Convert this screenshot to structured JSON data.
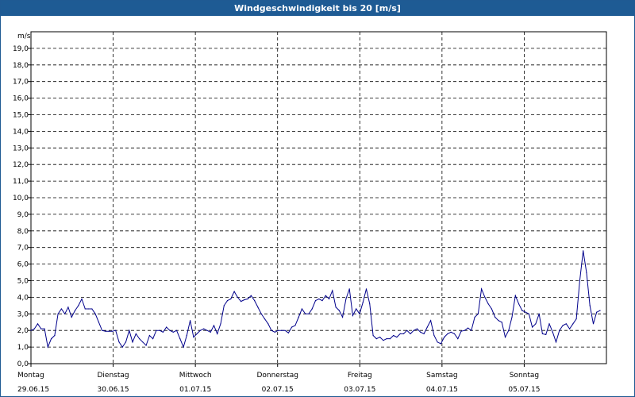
{
  "window": {
    "title": "Windgeschwindigkeit bis 20 [m/s]"
  },
  "chart_data": {
    "type": "line",
    "title": "Windgeschwindigkeit bis 20 [m/s]",
    "ylabel": "m/s",
    "xlabel": "",
    "ylim": [
      0,
      20
    ],
    "y_ticks": [
      "0,0",
      "1,0",
      "2,0",
      "3,0",
      "4,0",
      "5,0",
      "6,0",
      "7,0",
      "8,0",
      "9,0",
      "10,0",
      "11,0",
      "12,0",
      "13,0",
      "14,0",
      "15,0",
      "16,0",
      "17,0",
      "18,0",
      "19,0"
    ],
    "x_ticks": [
      {
        "day": "Montag",
        "date": "29.06.15"
      },
      {
        "day": "Dienstag",
        "date": "30.06.15"
      },
      {
        "day": "Mittwoch",
        "date": "01.07.15"
      },
      {
        "day": "Donnerstag",
        "date": "02.07.15"
      },
      {
        "day": "Freitag",
        "date": "03.07.15"
      },
      {
        "day": "Samstag",
        "date": "04.07.15"
      },
      {
        "day": "Sonntag",
        "date": "05.07.15"
      }
    ],
    "grid": true,
    "series": [
      {
        "color": "#00008b",
        "values": [
          2.0,
          2.1,
          2.4,
          2.1,
          2.1,
          1.0,
          1.5,
          1.7,
          3.0,
          3.3,
          3.0,
          3.4,
          2.8,
          3.2,
          3.5,
          3.9,
          3.3,
          3.3,
          3.3,
          3.0,
          2.5,
          2.0,
          1.95,
          1.95,
          1.95,
          2.0,
          1.3,
          1.0,
          1.3,
          2.0,
          1.3,
          1.8,
          1.5,
          1.3,
          1.1,
          1.7,
          1.5,
          2.0,
          2.0,
          1.9,
          2.2,
          2.0,
          1.9,
          2.0,
          1.5,
          1.0,
          1.7,
          2.6,
          1.6,
          1.8,
          2.0,
          2.1,
          2.0,
          1.9,
          2.3,
          1.8,
          2.4,
          3.5,
          3.8,
          3.9,
          4.35,
          4.0,
          3.75,
          3.85,
          3.9,
          4.1,
          3.8,
          3.4,
          3.0,
          2.7,
          2.4,
          2.0,
          1.9,
          2.0,
          2.0,
          2.0,
          1.85,
          2.2,
          2.3,
          2.8,
          3.3,
          3.0,
          3.0,
          3.3,
          3.8,
          3.9,
          3.8,
          4.1,
          3.9,
          4.4,
          3.4,
          3.2,
          2.8,
          3.9,
          4.5,
          2.9,
          3.3,
          3.0,
          3.7,
          4.5,
          3.6,
          1.7,
          1.5,
          1.6,
          1.4,
          1.5,
          1.5,
          1.7,
          1.6,
          1.8,
          1.8,
          2.0,
          1.8,
          2.0,
          2.1,
          1.9,
          1.8,
          2.2,
          2.6,
          1.7,
          1.3,
          1.2,
          1.6,
          1.8,
          1.9,
          1.8,
          1.5,
          1.95,
          2.0,
          2.15,
          2.0,
          2.8,
          3.0,
          4.5,
          4.0,
          3.6,
          3.3,
          2.8,
          2.6,
          2.5,
          1.6,
          2.0,
          2.8,
          4.1,
          3.6,
          3.2,
          3.1,
          3.0,
          2.2,
          2.4,
          3.0,
          1.8,
          1.75,
          2.4,
          1.9,
          1.3,
          2.0,
          2.3,
          2.4,
          2.1,
          2.4,
          2.7,
          5.0,
          6.8,
          5.5,
          3.5,
          2.4,
          3.1,
          3.2
        ]
      }
    ]
  }
}
